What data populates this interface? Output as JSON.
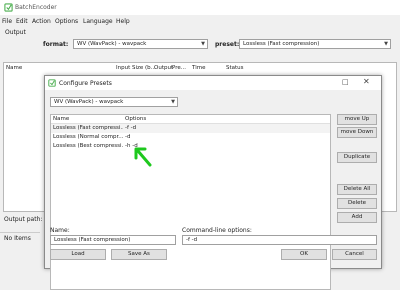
{
  "app": {
    "title": "BatchEncoder",
    "menu": [
      "File",
      "Edit",
      "Action",
      "Options",
      "Language",
      "Help"
    ]
  },
  "output_group": {
    "label": "Output",
    "format_label": "format:",
    "format_value": "WV (WavPack) - wavpack",
    "preset_label": "preset:",
    "preset_value": "Lossless (Fast compression)"
  },
  "file_list": {
    "columns": [
      "Name",
      "Input",
      "Size (b...",
      "Output",
      "Pre...",
      "Time",
      "Status"
    ]
  },
  "status": {
    "output_path_label": "Output path:",
    "items_text": "No Items"
  },
  "dialog": {
    "title": "Configure Presets",
    "format_value": "WV (WavPack) - wavpack",
    "table_headers": [
      "Name",
      "Options"
    ],
    "rows": [
      {
        "name": "Lossless (Fast compressi...",
        "options": "-f -d"
      },
      {
        "name": "Lossless (Normal compr...",
        "options": "-d"
      },
      {
        "name": "Lossless (Best compressi...",
        "options": "-h -d"
      }
    ],
    "buttons": {
      "move_up": "move Up",
      "move_down": "move Down",
      "duplicate": "Duplicate",
      "delete_all": "Delete All",
      "delete": "Delete",
      "add": "Add",
      "load": "Load",
      "save_as": "Save As",
      "ok": "OK",
      "cancel": "Cancel"
    },
    "name_label": "Name:",
    "name_value": "Lossless (Fast compression)",
    "cmd_label": "Command-line options:",
    "cmd_value": "-f -d"
  },
  "colors": {
    "accent": "#1ec81e",
    "selection": "#cce8ff"
  }
}
